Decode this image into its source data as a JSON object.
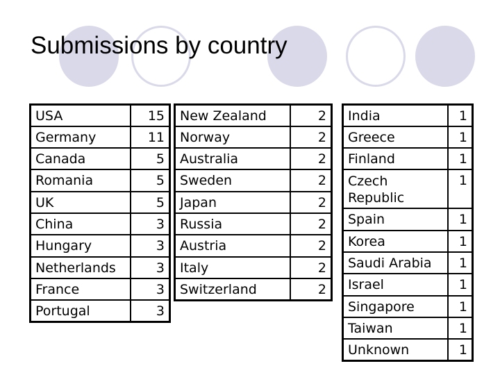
{
  "title": "Submissions by country",
  "decor": {
    "circle_color": "#d9d9ea",
    "circles": [
      "filled",
      "outline",
      "filled",
      "outline",
      "filled"
    ]
  },
  "tables": [
    {
      "rows": [
        {
          "country": "USA",
          "count": "15"
        },
        {
          "country": "Germany",
          "count": "11"
        },
        {
          "country": "Canada",
          "count": "5"
        },
        {
          "country": "Romania",
          "count": "5"
        },
        {
          "country": "UK",
          "count": "5"
        },
        {
          "country": "China",
          "count": "3"
        },
        {
          "country": "Hungary",
          "count": "3"
        },
        {
          "country": "Netherlands",
          "count": "3"
        },
        {
          "country": "France",
          "count": "3"
        },
        {
          "country": "Portugal",
          "count": "3"
        }
      ]
    },
    {
      "rows": [
        {
          "country": "New Zealand",
          "count": "2"
        },
        {
          "country": "Norway",
          "count": "2"
        },
        {
          "country": "Australia",
          "count": "2"
        },
        {
          "country": "Sweden",
          "count": "2"
        },
        {
          "country": "Japan",
          "count": "2"
        },
        {
          "country": "Russia",
          "count": "2"
        },
        {
          "country": "Austria",
          "count": "2"
        },
        {
          "country": "Italy",
          "count": "2"
        },
        {
          "country": "Switzerland",
          "count": "2"
        }
      ]
    },
    {
      "rows": [
        {
          "country": "India",
          "count": "1"
        },
        {
          "country": "Greece",
          "count": "1"
        },
        {
          "country": "Finland",
          "count": "1"
        },
        {
          "country": "Czech Republic",
          "count": "1"
        },
        {
          "country": "Spain",
          "count": "1"
        },
        {
          "country": "Korea",
          "count": "1"
        },
        {
          "country": "Saudi Arabia",
          "count": "1"
        },
        {
          "country": "Israel",
          "count": "1"
        },
        {
          "country": "Singapore",
          "count": "1"
        },
        {
          "country": "Taiwan",
          "count": "1"
        },
        {
          "country": "Unknown",
          "count": "1"
        }
      ]
    }
  ]
}
